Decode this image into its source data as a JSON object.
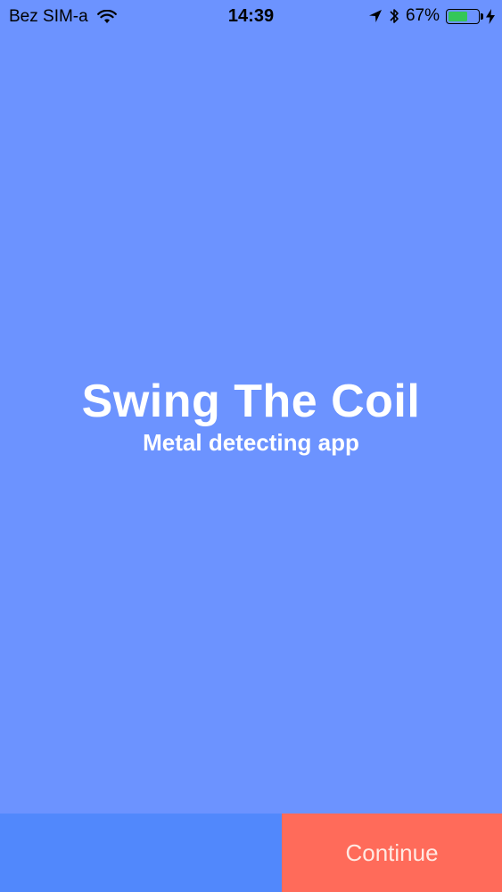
{
  "status_bar": {
    "carrier": "Bez SIM-a",
    "time": "14:39",
    "battery_percent_label": "67%",
    "battery_level": 0.67,
    "icons": [
      "wifi-icon",
      "location-arrow-icon",
      "bluetooth-icon",
      "battery-icon",
      "charging-bolt-icon"
    ]
  },
  "hero": {
    "title": "Swing The Coil",
    "subtitle": "Metal detecting app"
  },
  "bottom_bar": {
    "continue_label": "Continue"
  },
  "colors": {
    "background": "#6c93ff",
    "bottom_left": "#5188fc",
    "continue_button": "#ff6b5a",
    "text": "#ffffff",
    "battery": "#34c759"
  }
}
